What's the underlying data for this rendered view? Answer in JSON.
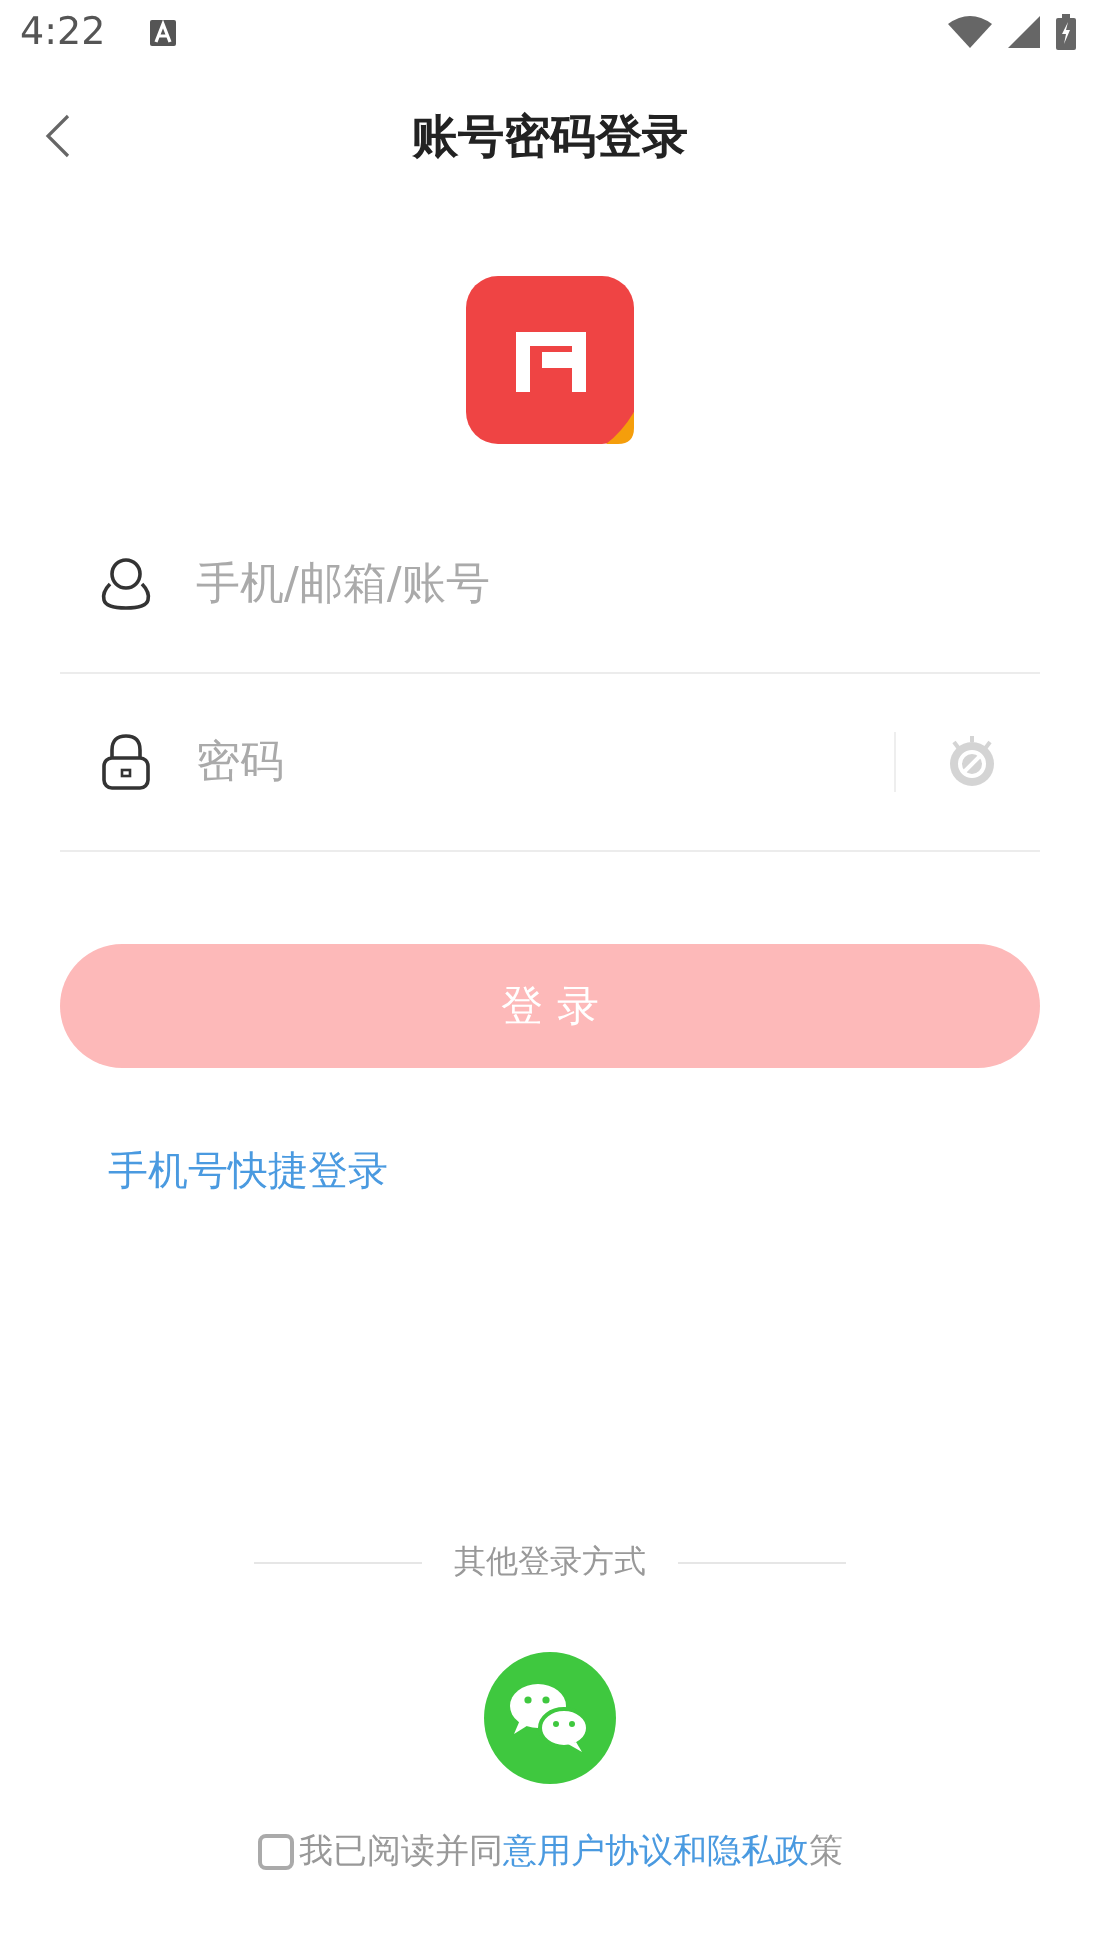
{
  "status_bar": {
    "time": "4:22"
  },
  "header": {
    "title": "账号密码登录"
  },
  "fields": [
    {
      "kind": "account",
      "placeholder": "手机/邮箱/账号"
    },
    {
      "kind": "password",
      "placeholder": "密码"
    }
  ],
  "login_button": {
    "label": "登 录",
    "disabled": true
  },
  "quick_login_link": "手机号快捷登录",
  "other_methods": {
    "label": "其他登录方式"
  },
  "agreement": {
    "checked": false,
    "before": "我已阅读并同",
    "link": "意用户协议和隐私政",
    "after": "策"
  }
}
